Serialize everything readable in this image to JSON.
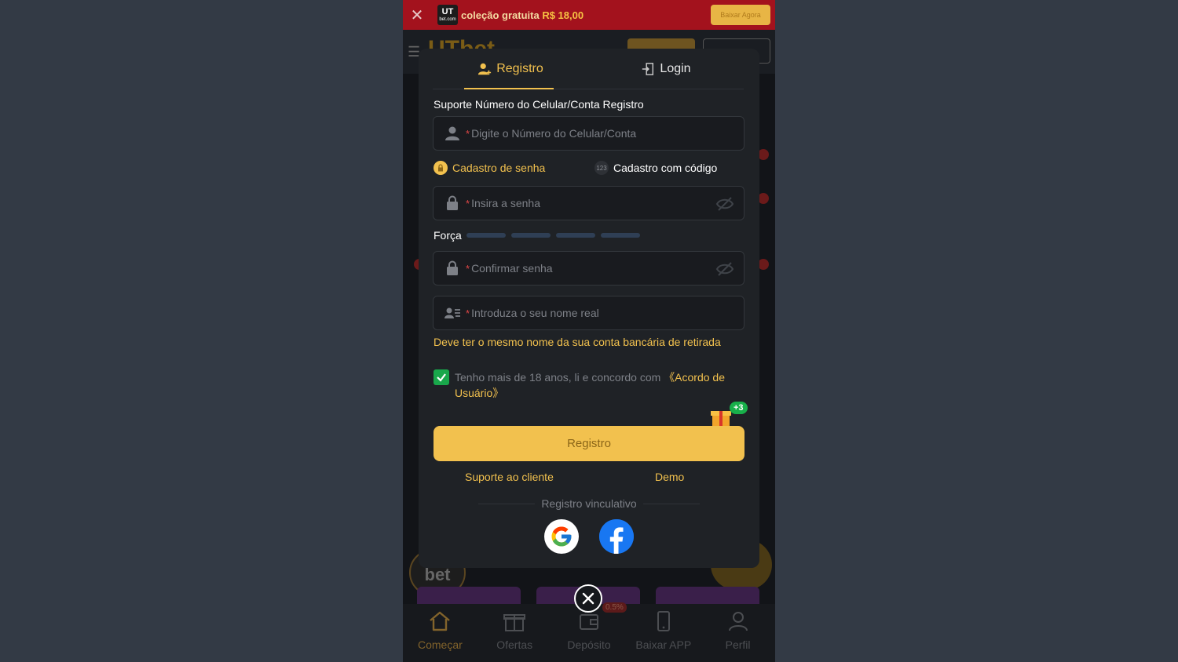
{
  "banner": {
    "logo_top": "UT",
    "logo_bottom": "bet.com",
    "text_prefix": "coleção gratuita ",
    "amount": "R$ 18,00",
    "button": "Baixar Agora"
  },
  "background": {
    "brand": "UTbet",
    "wheel_label": ""
  },
  "bottom_nav": {
    "items": [
      {
        "label": "Começar",
        "icon": "home-icon"
      },
      {
        "label": "Ofertas",
        "icon": "gift-icon"
      },
      {
        "label": "Depósito",
        "icon": "wallet-icon"
      },
      {
        "label": "Baixar APP",
        "icon": "phone-icon"
      },
      {
        "label": "Perfil",
        "icon": "user-icon"
      }
    ],
    "deposit_badge": "0.5%"
  },
  "modal": {
    "tabs": [
      {
        "label": "Registro",
        "active": true
      },
      {
        "label": "Login",
        "active": false
      }
    ],
    "section_label": "Suporte Número do Celular/Conta Registro",
    "account_placeholder": "Digite o Número do Celular/Conta",
    "options": {
      "password": {
        "label": "Cadastro de senha",
        "active": true
      },
      "code": {
        "label": "Cadastro com código",
        "badge": "123",
        "active": false
      }
    },
    "password_placeholder": "Insira a senha",
    "strength_label": "Força",
    "confirm_placeholder": "Confirmar senha",
    "realname_placeholder": "Introduza o seu nome real",
    "realname_hint": "Deve ter o mesmo nome da sua conta bancária de retirada",
    "agreement": {
      "checked": true,
      "text": "Tenho mais de 18 anos, li e concordo com ",
      "link": "《Acordo de Usuário》"
    },
    "gift_badge": "+3",
    "register_button": "Registro",
    "support_link": "Suporte ao cliente",
    "demo_link": "Demo",
    "divider_text": "Registro vinculativo",
    "social": [
      "google-icon",
      "facebook-icon"
    ]
  },
  "colors": {
    "accent": "#f2c14e",
    "banner_bg": "#a3121d",
    "check_green": "#19a74b",
    "modal_bg": "#1f2226"
  }
}
